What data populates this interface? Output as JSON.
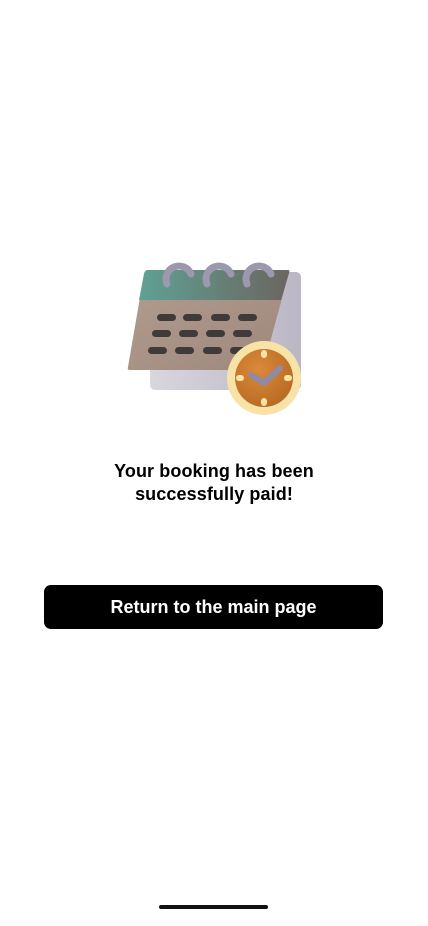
{
  "confirmation": {
    "illustration_icon": "calendar-clock-icon",
    "message_line1": "Your booking has been",
    "message_line2": "successfully paid!"
  },
  "actions": {
    "return_label": "Return to the main page"
  },
  "colors": {
    "button_background": "#000000",
    "button_text": "#ffffff",
    "calendar_header": "#6f9b8e",
    "calendar_body": "#a88e82",
    "clock_face": "#c9782c",
    "clock_ring": "#f7e3a7"
  }
}
